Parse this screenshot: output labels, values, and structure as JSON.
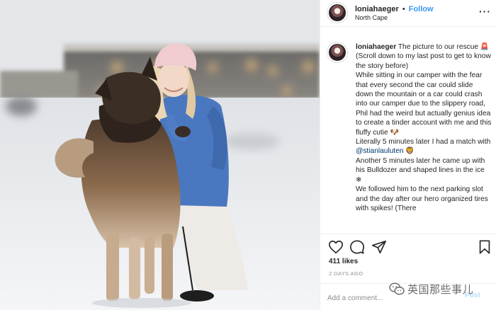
{
  "post": {
    "username": "loniahaeger",
    "separator": "•",
    "follow_label": "Follow",
    "location": "North Cape",
    "more_icon": "more-options-icon",
    "more_glyph": "···"
  },
  "caption": {
    "username": "loniahaeger",
    "lines": [
      {
        "text": " The picture to our rescue ",
        "emoji": "🚨"
      },
      {
        "text": "(Scroll down to my last post to get to know the story before)"
      },
      {
        "text": "While sitting in our camper with the fear that every second the car could slide down the mountain or a car could crash into our camper due to the slippery road, Phil had the weird but actually genius idea to create a tinder account with me and this fluffy cutie ",
        "emoji": "🐶"
      },
      {
        "text": "Literally 5 minutes later I had a match with ",
        "mention": "@stianlauluten",
        "emoji": "🦁"
      },
      {
        "text": "Another 5 minutes later he came up with his Bulldozer and shaped lines in the ice ",
        "emoji": "❄"
      },
      {
        "text": "We followed him to the next parking slot and the day after our hero organized tires with spikes! (There"
      }
    ]
  },
  "actions": {
    "like_icon": "heart-icon",
    "comment_icon": "comment-icon",
    "share_icon": "share-icon",
    "save_icon": "bookmark-icon"
  },
  "stats": {
    "likes": "411 likes",
    "timestamp": "2 DAYS AGO"
  },
  "comment": {
    "placeholder": "Add a comment...",
    "post_label": "Post"
  },
  "watermark": {
    "text": "英国那些事儿"
  },
  "colors": {
    "link_blue": "#3897f0",
    "mention": "#00376b",
    "muted": "#8e8e8e",
    "jacket": "#4a78c0",
    "hat": "#f0ccd0"
  }
}
